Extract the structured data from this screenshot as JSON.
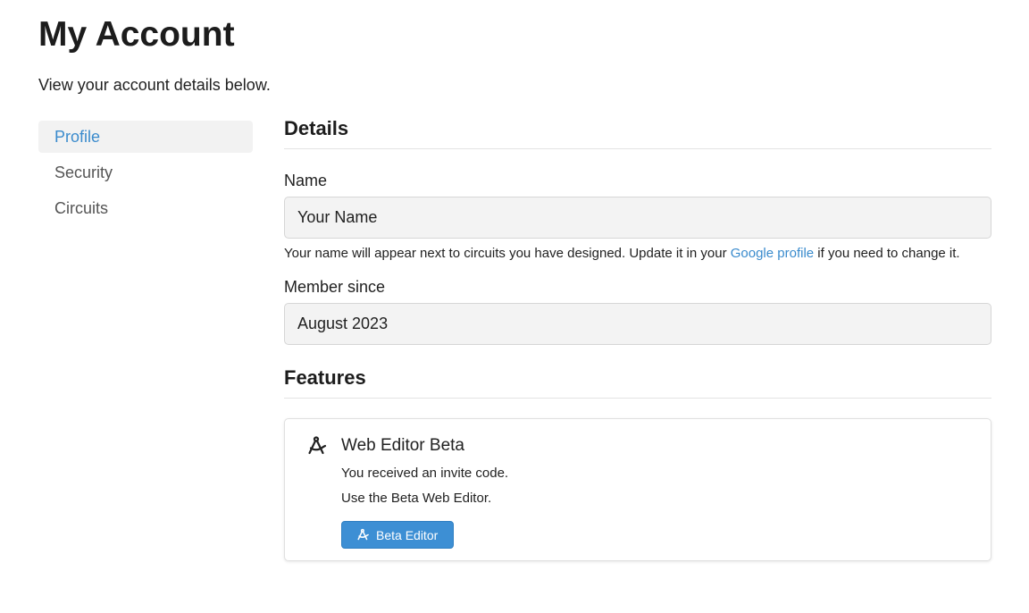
{
  "header": {
    "title": "My Account",
    "subtitle": "View your account details below."
  },
  "sidebar": {
    "items": [
      {
        "label": "Profile",
        "active": true
      },
      {
        "label": "Security",
        "active": false
      },
      {
        "label": "Circuits",
        "active": false
      }
    ]
  },
  "details": {
    "heading": "Details",
    "name_label": "Name",
    "name_value": "Your Name",
    "name_help_before": "Your name will appear next to circuits you have designed. Update it in your ",
    "name_help_link": "Google profile",
    "name_help_after": " if you need to change it.",
    "member_since_label": "Member since",
    "member_since_value": "August 2023"
  },
  "features": {
    "heading": "Features",
    "card": {
      "icon": "drafting-compass-icon",
      "title": "Web Editor Beta",
      "line1": "You received an invite code.",
      "line2": "Use the Beta Web Editor.",
      "button_label": "Beta Editor",
      "button_icon": "drafting-compass-icon"
    }
  },
  "colors": {
    "accent": "#3a8bcd",
    "button_bg": "#3d8fd4",
    "active_sidebar_bg": "#f2f2f2",
    "input_bg": "#f3f3f3"
  }
}
